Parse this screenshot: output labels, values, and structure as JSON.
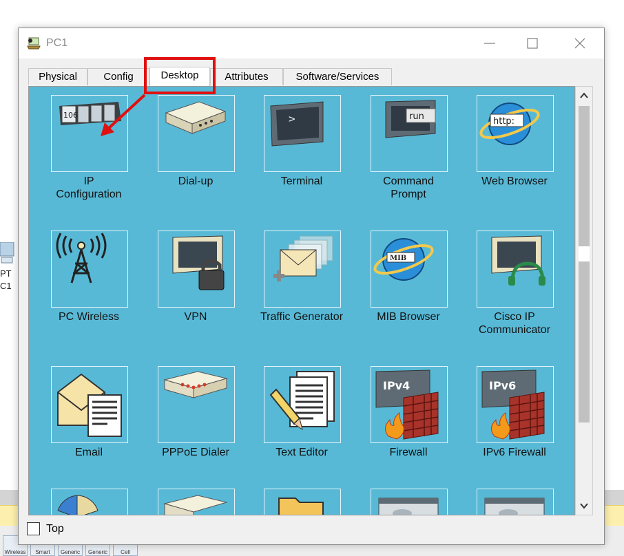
{
  "window": {
    "title": "PC1"
  },
  "tabs": [
    {
      "label": "Physical"
    },
    {
      "label": "Config"
    },
    {
      "label": "Desktop",
      "active": true
    },
    {
      "label": "Attributes"
    },
    {
      "label": "Software/Services"
    }
  ],
  "apps": [
    {
      "label": "IP\nConfiguration",
      "icon": "ip-configuration-icon",
      "badge": "106"
    },
    {
      "label": "Dial-up",
      "icon": "modem-icon"
    },
    {
      "label": "Terminal",
      "icon": "terminal-icon",
      "badge": ">"
    },
    {
      "label": "Command\nPrompt",
      "icon": "command-prompt-icon",
      "badge": "run"
    },
    {
      "label": "Web Browser",
      "icon": "web-browser-icon",
      "badge": "http:"
    },
    {
      "label": "PC Wireless",
      "icon": "wireless-antenna-icon"
    },
    {
      "label": "VPN",
      "icon": "vpn-lock-icon"
    },
    {
      "label": "Traffic Generator",
      "icon": "traffic-generator-icon"
    },
    {
      "label": "MIB Browser",
      "icon": "mib-browser-icon",
      "badge": "MIB"
    },
    {
      "label": "Cisco IP\nCommunicator",
      "icon": "headset-monitor-icon"
    },
    {
      "label": "Email",
      "icon": "email-icon"
    },
    {
      "label": "PPPoE Dialer",
      "icon": "pppoe-dialer-icon"
    },
    {
      "label": "Text Editor",
      "icon": "text-editor-icon"
    },
    {
      "label": "Firewall",
      "icon": "firewall-icon",
      "badge": "IPv4"
    },
    {
      "label": "IPv6 Firewall",
      "icon": "ipv6-firewall-icon",
      "badge": "IPv6"
    }
  ],
  "footer": {
    "top_checkbox_label": "Top",
    "top_checked": false
  },
  "background": {
    "left_label_line1": "PT",
    "left_label_line2": "C1",
    "tools": [
      "Wireless",
      "Smart",
      "Generic",
      "Generic",
      "Cell"
    ]
  },
  "colors": {
    "desktop_bg": "#58b9d6",
    "highlight": "#e01010"
  }
}
